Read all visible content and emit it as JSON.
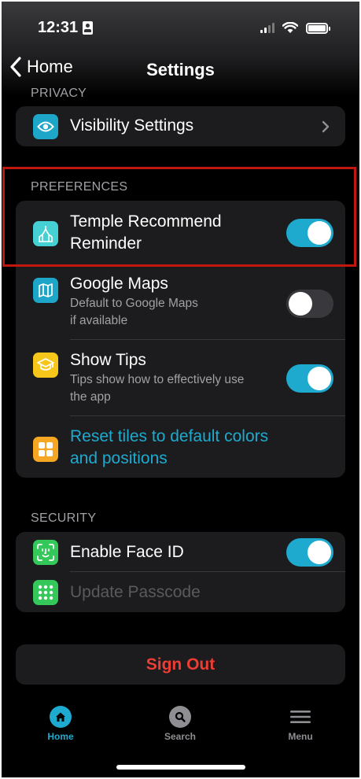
{
  "status_bar": {
    "time": "12:31"
  },
  "nav": {
    "back_label": "Home",
    "title": "Settings"
  },
  "privacy": {
    "header": "PRIVACY",
    "items": [
      {
        "label": "Visibility Settings",
        "icon": "eye-icon",
        "icon_color": "#1ea6c9"
      }
    ]
  },
  "preferences": {
    "header": "PREFERENCES",
    "items": [
      {
        "label_line1": "Temple Recommend",
        "label_line2": "Reminder",
        "icon": "temple-icon",
        "icon_color": "#45d0d3",
        "toggle": "on"
      },
      {
        "label": "Google Maps",
        "sub_line1": "Default to Google Maps",
        "sub_line2": "if available",
        "icon": "map-icon",
        "icon_color": "#1ea6c9",
        "toggle": "off"
      },
      {
        "label": "Show Tips",
        "sub_line1": "Tips show how to effectively use",
        "sub_line2": "the app",
        "icon": "graduation-cap-icon",
        "icon_color": "#f6c71a",
        "toggle": "on"
      },
      {
        "label_line1": "Reset tiles to default colors",
        "label_line2": "and positions",
        "icon": "tiles-icon",
        "icon_color": "#f5a623",
        "link_color": "#1eaacf"
      }
    ]
  },
  "security": {
    "header": "SECURITY",
    "items": [
      {
        "label": "Enable Face ID",
        "icon": "face-id-icon",
        "icon_color": "#34c759",
        "toggle": "on"
      },
      {
        "label": "Update Passcode",
        "icon": "keypad-icon",
        "icon_color": "#34c759",
        "disabled": true
      }
    ]
  },
  "sign_out": {
    "label": "Sign Out",
    "color": "#ee3d33"
  },
  "tabbar": {
    "items": [
      {
        "label": "Home",
        "icon": "home-icon",
        "active": true
      },
      {
        "label": "Search",
        "icon": "search-icon",
        "active": false
      },
      {
        "label": "Menu",
        "icon": "menu-icon",
        "active": false
      }
    ]
  },
  "colors": {
    "accent": "#1eaacf",
    "card": "#1c1c1e",
    "highlight_border": "#c0170f"
  }
}
